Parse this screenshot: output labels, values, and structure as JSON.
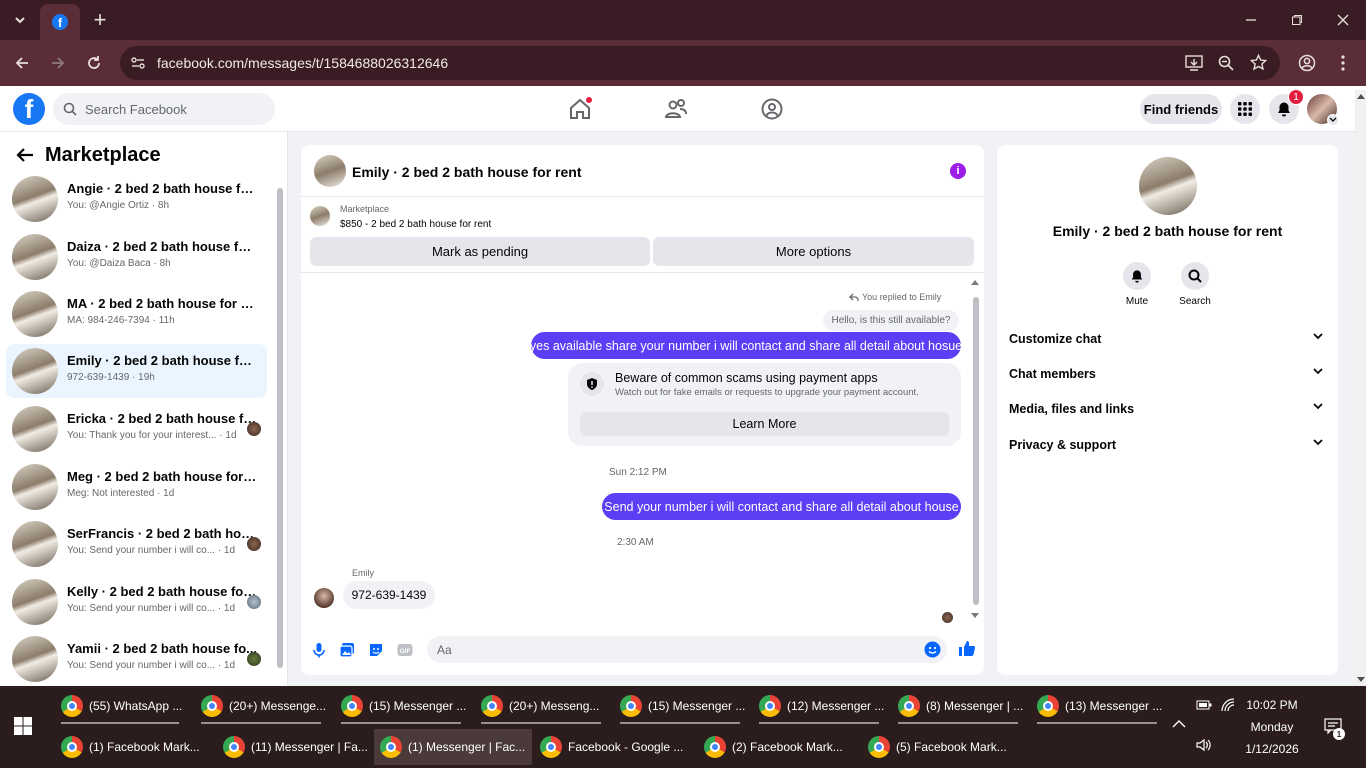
{
  "browser": {
    "url": "facebook.com/messages/t/1584688026312646",
    "tab_favicon": "facebook-icon",
    "new_tab": "+",
    "window_controls": [
      "minimize",
      "maximize",
      "close"
    ]
  },
  "fb_header": {
    "search_placeholder": "Search Facebook",
    "find_friends": "Find friends",
    "notification_count": "1"
  },
  "sidebar": {
    "title": "Marketplace",
    "conversations": [
      {
        "name": "Angie · 2 bed 2 bath house for r...",
        "sub": "You: @Angie Ortiz · 8h"
      },
      {
        "name": "Daiza · 2 bed 2 bath house for r...",
        "sub": "You: @Daiza Baca · 8h"
      },
      {
        "name": "MA · 2 bed 2 bath house for rent",
        "sub": "MA: 984-246-7394 · 11h"
      },
      {
        "name": "Emily · 2 bed 2 bath house for r...",
        "sub": "972-639-1439 · 19h"
      },
      {
        "name": "Ericka · 2 bed 2 bath house fo...",
        "sub": "You: Thank you for your interest... · 1d"
      },
      {
        "name": "Meg · 2 bed 2 bath house for rent",
        "sub": "Meg: Not interested · 1d"
      },
      {
        "name": "SerFrancis · 2 bed 2 bath hou...",
        "sub": "You: Send your number i will co... · 1d"
      },
      {
        "name": "Kelly · 2 bed 2 bath house for...",
        "sub": "You: Send your number i will co... · 1d"
      },
      {
        "name": "Yamii · 2 bed 2 bath house fo...",
        "sub": "You: Send your number i will co... · 1d"
      }
    ]
  },
  "chat": {
    "title": "Emily · 2 bed 2 bath house for rent",
    "marketplace_label": "Marketplace",
    "listing": "$850 - 2 bed 2 bath house for rent",
    "mark_pending": "Mark as pending",
    "more_options": "More options",
    "reply_note": "You replied to Emily",
    "quoted": "Hello, is this still available?",
    "msg1": "yes available share your number i will contact and share all detail about hosue",
    "warning_title": "Beware of common scams using payment apps",
    "warning_text": "Watch out for fake emails or requests to upgrade your payment account.",
    "learn_more": "Learn More",
    "time1": "Sun 2:12 PM",
    "msg2": "Send your number i will contact and share all detail about house",
    "time2": "2:30 AM",
    "sender": "Emily",
    "msg3": "972-639-1439",
    "input_placeholder": "Aa"
  },
  "right_panel": {
    "name": "Emily · 2 bed 2 bath house for rent",
    "mute": "Mute",
    "search": "Search",
    "sections": [
      "Customize chat",
      "Chat members",
      "Media, files and links",
      "Privacy & support"
    ]
  },
  "taskbar": {
    "row1": [
      "(55) WhatsApp ...",
      "(20+) Messenge...",
      "(15) Messenger ...",
      "(20+) Messeng...",
      "(15) Messenger ...",
      "(12) Messenger ...",
      "(8) Messenger | ...",
      "(13) Messenger ..."
    ],
    "row2": [
      "(1) Facebook Mark...",
      "(11) Messenger | Fa...",
      "(1) Messenger | Fac...",
      "Facebook - Google ...",
      "(2) Facebook Mark...",
      "(5) Facebook Mark..."
    ],
    "time": "10:02 PM",
    "day": "Monday",
    "date": "1/12/2026",
    "chat_badge": "1"
  }
}
